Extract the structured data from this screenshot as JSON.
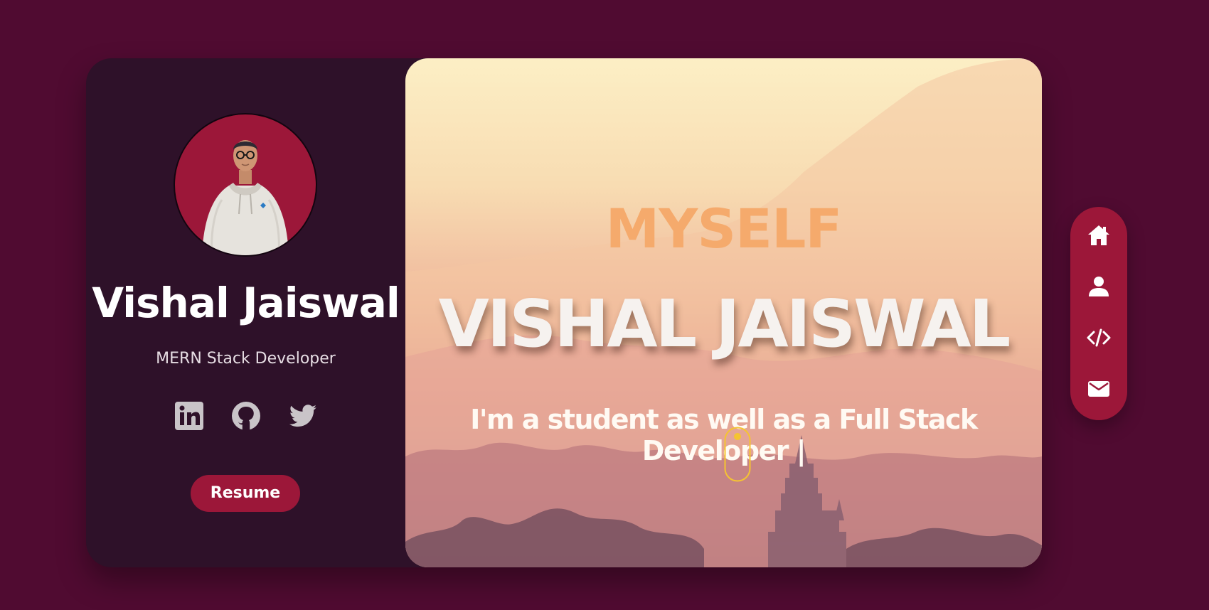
{
  "profile": {
    "name": "Vishal Jaiswal",
    "role": "MERN Stack Developer",
    "resume_label": "Resume"
  },
  "social_icons": [
    "linkedin-icon",
    "github-icon",
    "twitter-icon"
  ],
  "hero": {
    "label": "MYSELF",
    "name": "VISHAL JAISWAL",
    "tagline": "I'm a student as well as a Full Stack Developer |"
  },
  "nav_icons": [
    "home-icon",
    "user-icon",
    "code-icon",
    "mail-icon"
  ],
  "colors": {
    "page_background": "#500b31",
    "card_background": "#2e1129",
    "accent": "#9c1739",
    "hero_label": "#f5aa6c",
    "scroll_indicator": "#f5c431"
  }
}
